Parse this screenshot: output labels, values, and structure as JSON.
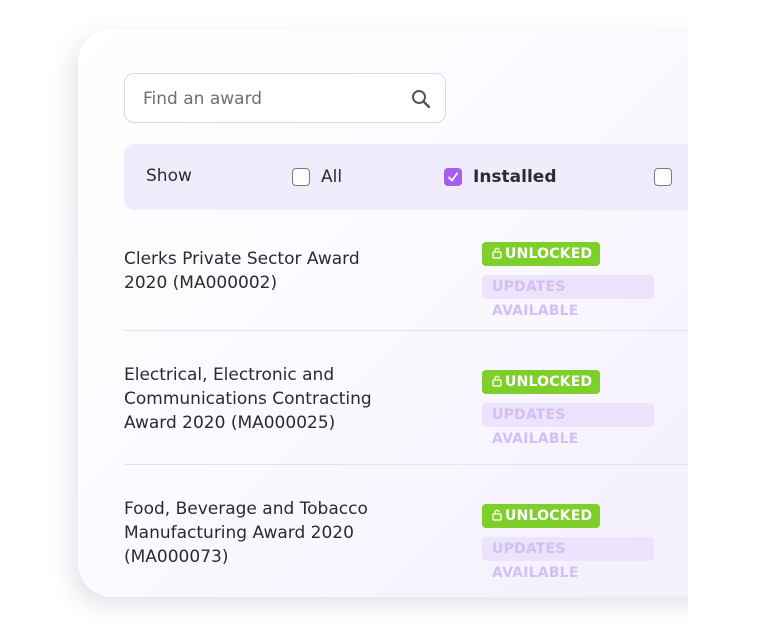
{
  "search": {
    "placeholder": "Find an award",
    "value": ""
  },
  "filters": {
    "show_label": "Show",
    "options": [
      {
        "label": "All",
        "checked": false
      },
      {
        "label": "Installed",
        "checked": true
      },
      {
        "label": "",
        "checked": false
      }
    ]
  },
  "awards": [
    {
      "title": "Clerks Private Sector Award 2020 (MA000002)",
      "status_badge": "UNLOCKED",
      "update_badge": "UPDATES AVAILABLE"
    },
    {
      "title": "Electrical, Electronic and Communications Contracting Award 2020 (MA000025)",
      "status_badge": "UNLOCKED",
      "update_badge": "UPDATES AVAILABLE"
    },
    {
      "title": "Food, Beverage and Tobacco Manufacturing Award 2020 (MA000073)",
      "status_badge": "UNLOCKED",
      "update_badge": "UPDATES AVAILABLE"
    }
  ],
  "colors": {
    "accent_purple": "#a55df0",
    "unlocked_green": "#7fcf2a",
    "updates_bg": "#ece3fc",
    "filter_bar_bg": "#f1ecfc"
  },
  "icons": {
    "search": "search-icon",
    "lock": "unlocked-lock-icon",
    "check": "checkmark-icon"
  }
}
